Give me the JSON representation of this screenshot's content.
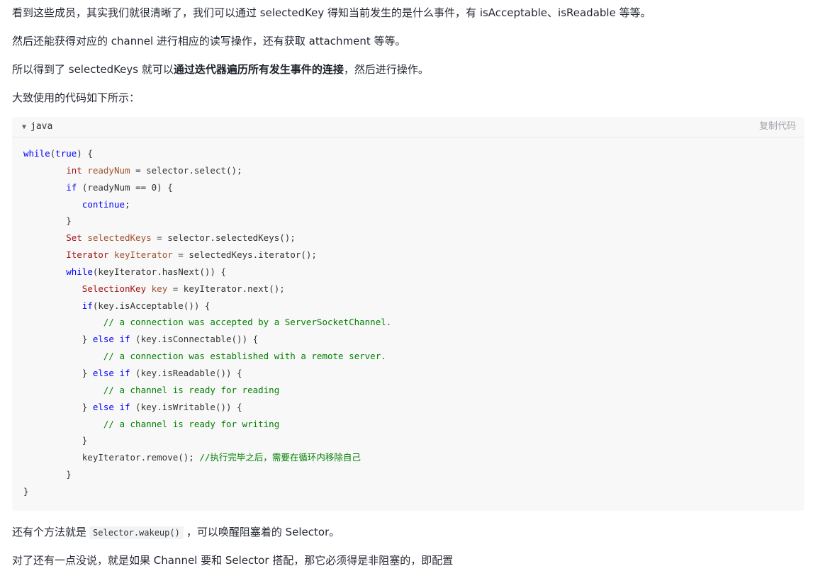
{
  "paragraphs": {
    "p1": "看到这些成员，其实我们就很清晰了，我们可以通过 selectedKey 得知当前发生的是什么事件，有 isAcceptable、isReadable 等等。",
    "p2": "然后还能获得对应的 channel 进行相应的读写操作，还有获取 attachment 等等。",
    "p3_before": "所以得到了 selectedKeys 就可以",
    "p3_bold": "通过迭代器遍历所有发生事件的连接",
    "p3_after": "，然后进行操作。",
    "p4": "大致使用的代码如下所示：",
    "p5_before": "还有个方法就是",
    "p5_code": "Selector.wakeup()",
    "p5_after": "，可以唤醒阻塞着的 Selector。",
    "p6": "对了还有一点没说，就是如果 Channel 要和 Selector 搭配，那它必须得是非阻塞的，即配置"
  },
  "code_block": {
    "language": "java",
    "copy_label": "复制代码",
    "lines": [
      [
        [
          "kw",
          "while"
        ],
        [
          "p",
          "("
        ],
        [
          "kw",
          "true"
        ],
        [
          "p",
          ") {"
        ]
      ],
      [
        [
          "p",
          "        "
        ],
        [
          "ty",
          "int"
        ],
        [
          "p",
          " "
        ],
        [
          "nm",
          "readyNum"
        ],
        [
          "p",
          " = selector.select();"
        ]
      ],
      [
        [
          "p",
          "        "
        ],
        [
          "kw",
          "if"
        ],
        [
          "p",
          " (readyNum == 0) {"
        ]
      ],
      [
        [
          "p",
          "           "
        ],
        [
          "kw",
          "continue"
        ],
        [
          "p",
          ";"
        ]
      ],
      [
        [
          "p",
          "        }"
        ]
      ],
      [
        [
          "p",
          "        "
        ],
        [
          "ty",
          "Set"
        ],
        [
          "p",
          " "
        ],
        [
          "nm",
          "selectedKeys"
        ],
        [
          "p",
          " = selector.selectedKeys();"
        ]
      ],
      [
        [
          "p",
          "        "
        ],
        [
          "ty",
          "Iterator"
        ],
        [
          "p",
          " "
        ],
        [
          "nm",
          "keyIterator"
        ],
        [
          "p",
          " = selectedKeys.iterator();"
        ]
      ],
      [
        [
          "p",
          "        "
        ],
        [
          "kw",
          "while"
        ],
        [
          "p",
          "(keyIterator.hasNext()) {"
        ]
      ],
      [
        [
          "p",
          "           "
        ],
        [
          "ty",
          "SelectionKey"
        ],
        [
          "p",
          " "
        ],
        [
          "nm",
          "key"
        ],
        [
          "p",
          " = keyIterator.next();"
        ]
      ],
      [
        [
          "p",
          "           "
        ],
        [
          "kw",
          "if"
        ],
        [
          "p",
          "(key.isAcceptable()) {"
        ]
      ],
      [
        [
          "p",
          "               "
        ],
        [
          "cm",
          "// a connection was accepted by a ServerSocketChannel."
        ]
      ],
      [
        [
          "p",
          "           } "
        ],
        [
          "kw",
          "else if"
        ],
        [
          "p",
          " (key.isConnectable()) {"
        ]
      ],
      [
        [
          "p",
          "               "
        ],
        [
          "cm",
          "// a connection was established with a remote server."
        ]
      ],
      [
        [
          "p",
          "           } "
        ],
        [
          "kw",
          "else if"
        ],
        [
          "p",
          " (key.isReadable()) {"
        ]
      ],
      [
        [
          "p",
          "               "
        ],
        [
          "cm",
          "// a channel is ready for reading"
        ]
      ],
      [
        [
          "p",
          "           } "
        ],
        [
          "kw",
          "else if"
        ],
        [
          "p",
          " (key.isWritable()) {"
        ]
      ],
      [
        [
          "p",
          "               "
        ],
        [
          "cm",
          "// a channel is ready for writing"
        ]
      ],
      [
        [
          "p",
          "           }"
        ]
      ],
      [
        [
          "p",
          "           keyIterator.remove(); "
        ],
        [
          "cm",
          "//执行完毕之后，需要在循环内移除自己"
        ]
      ],
      [
        [
          "p",
          "        }"
        ]
      ],
      [
        [
          "p",
          "}"
        ]
      ]
    ]
  }
}
